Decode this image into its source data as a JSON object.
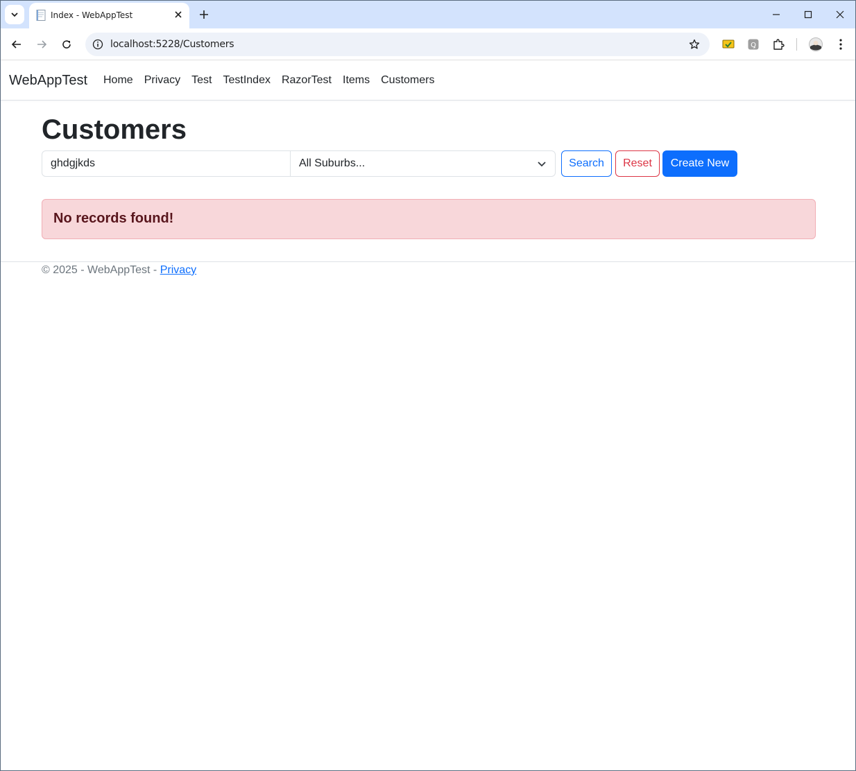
{
  "browser": {
    "tab_title": "Index - WebAppTest",
    "url": "localhost:5228/Customers",
    "icons": [
      "tab-search-icon",
      "close-icon",
      "plus-icon",
      "minimize-icon",
      "maximize-icon",
      "window-close-icon",
      "back-arrow-icon",
      "forward-arrow-icon",
      "reload-icon",
      "site-info-icon",
      "star-icon",
      "extension-icon",
      "puzzle-icon",
      "profile-avatar",
      "more-vert-icon"
    ]
  },
  "navbar": {
    "brand": "WebAppTest",
    "links": [
      "Home",
      "Privacy",
      "Test",
      "TestIndex",
      "RazorTest",
      "Items",
      "Customers"
    ]
  },
  "main": {
    "title": "Customers",
    "search_value": "ghdgjkds",
    "suburb_selected": "All Suburbs...",
    "search_button": "Search",
    "reset_button": "Reset",
    "create_button": "Create New",
    "alert_text": "No records found!"
  },
  "footer": {
    "copyright": "© 2025 - WebAppTest - ",
    "privacy_link": "Privacy"
  },
  "colors": {
    "primary": "#0d6efd",
    "danger": "#dc3545",
    "alert_bg": "#f8d7da",
    "alert_text": "#58151c",
    "tabstrip": "#d3e3fd"
  }
}
